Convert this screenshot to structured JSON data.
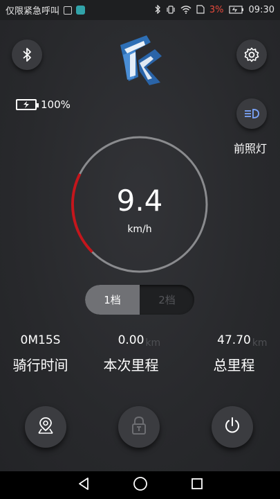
{
  "status_bar": {
    "carrier": "仅限紧急呼叫",
    "battery_percent": "3%",
    "time": "09:30"
  },
  "top_bar": {
    "bluetooth_icon": "bluetooth-icon",
    "logo_icon": "k-logo-icon",
    "settings_icon": "gear-icon"
  },
  "battery": {
    "icon": "battery-charging-icon",
    "level_text": "100%"
  },
  "headlight": {
    "icon": "headlight-icon",
    "label": "前照灯"
  },
  "gauge": {
    "speed": "9.4",
    "unit": "km/h",
    "progress_fraction": 0.2
  },
  "gear_selector": {
    "options": [
      "1档",
      "2档"
    ],
    "selected_index": 0
  },
  "stats": [
    {
      "value": "0M15S",
      "unit": "",
      "label": "骑行时间"
    },
    {
      "value": "0.00",
      "unit": "km",
      "label": "本次里程"
    },
    {
      "value": "47.70",
      "unit": "km",
      "label": "总里程"
    }
  ],
  "bottom_actions": {
    "location_icon": "map-pin-icon",
    "lock_icon": "lock-icon",
    "power_icon": "power-icon"
  },
  "nav_bar": {
    "back_icon": "back-triangle-icon",
    "home_icon": "home-circle-icon",
    "recents_icon": "recents-square-icon"
  },
  "colors": {
    "background": "#2a2b2e",
    "gauge_track": "#8a8b8e",
    "gauge_active": "#c4161c",
    "gear_active": "#707175"
  }
}
